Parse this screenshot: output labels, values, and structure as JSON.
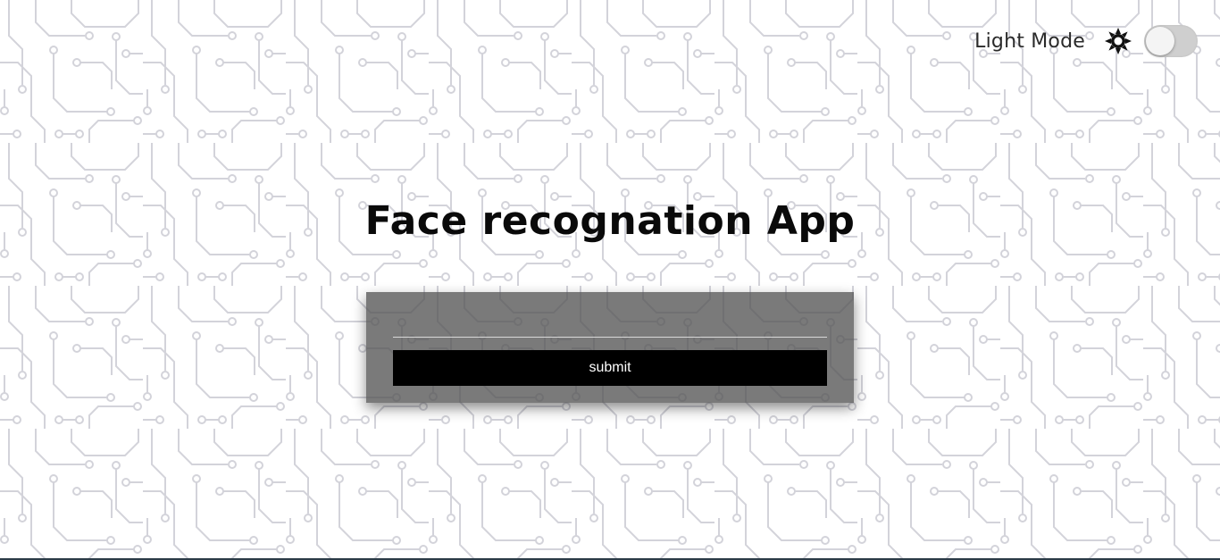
{
  "header": {
    "mode_label": "Light Mode",
    "mode_icon": "sun-icon",
    "toggle_state": "off"
  },
  "main": {
    "title": "Face recognation App",
    "input_value": "",
    "input_placeholder": "",
    "submit_label": "submit"
  },
  "colors": {
    "background": "#ffffff",
    "circuit_lines": "#d3d3da",
    "card_overlay": "#555555",
    "button": "#000000",
    "toggle_track": "#cfcfcf"
  }
}
